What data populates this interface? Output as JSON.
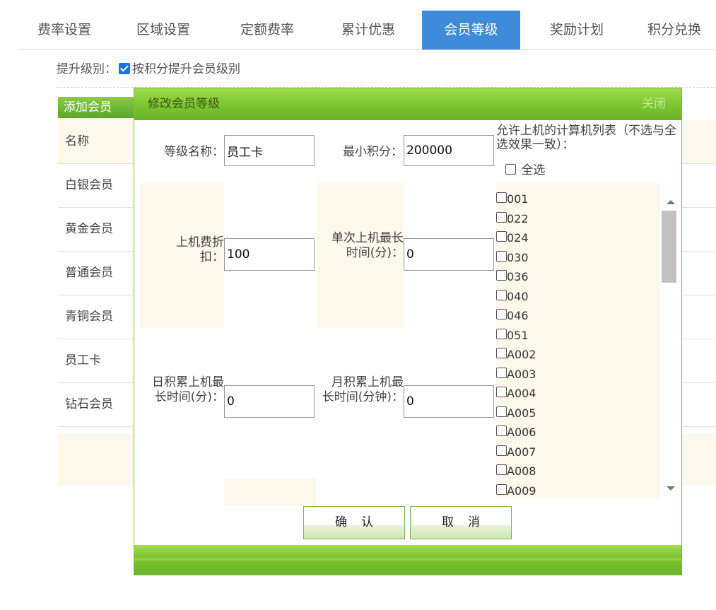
{
  "tabs": [
    {
      "label": "费率设置",
      "active": false
    },
    {
      "label": "区域设置",
      "active": false
    },
    {
      "label": "定额费率",
      "active": false
    },
    {
      "label": "累计优惠",
      "active": false
    },
    {
      "label": "会员等级",
      "active": true
    },
    {
      "label": "奖励计划",
      "active": false
    },
    {
      "label": "积分兑换",
      "active": false
    }
  ],
  "promote": {
    "label": "提升级别：",
    "checkbox_label": "按积分提升会员级别",
    "checked": true
  },
  "list": {
    "add_button": "添加会员",
    "header": "名称",
    "rows": [
      "白银会员",
      "黄金会员",
      "普通会员",
      "青铜会员",
      "员工卡",
      "钻石会员"
    ]
  },
  "dialog": {
    "title": "修改会员等级",
    "close_label": "关闭",
    "name_label": "等级名称：",
    "name_value": "员工卡",
    "min_points_label": "最小积分：",
    "min_points_value": "200000",
    "discount_label": "上机费折扣：",
    "discount_value": "100",
    "single_max_label": "单次上机最长时间(分)：",
    "single_max_value": "0",
    "daily_max_label": "日积累上机最长时间(分)：",
    "daily_max_value": "0",
    "monthly_max_label": "月积累上机最长时间(分钟)：",
    "monthly_max_value": "0",
    "pc_list_label": "允许上机的计算机列表（不选与全选效果一致）：",
    "select_all_label": "全选",
    "pcs": [
      "001",
      "022",
      "024",
      "030",
      "036",
      "040",
      "046",
      "051",
      "A002",
      "A003",
      "A004",
      "A005",
      "A006",
      "A007",
      "A008",
      "A009"
    ],
    "confirm_label": "确认",
    "cancel_label": "取消"
  },
  "colors": {
    "tab_active": "#3d8bd9",
    "dialog_green": "#7bc531",
    "cream": "#fdf8ec"
  }
}
